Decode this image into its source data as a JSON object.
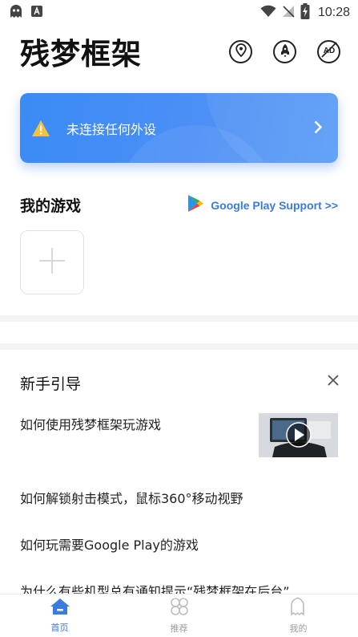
{
  "status_bar": {
    "time": "10:28"
  },
  "header": {
    "title": "残梦框架"
  },
  "device_card": {
    "text": "未连接任何外设"
  },
  "my_games": {
    "title": "我的游戏",
    "google_play_link": "Google Play Support >>"
  },
  "guide": {
    "title": "新手引导",
    "items": [
      "如何使用残梦框架玩游戏",
      "如何解锁射击模式，鼠标360°移动视野",
      "如何玩需要Google Play的游戏",
      "为什么有些机型总有通知提示“残梦框架在后台”"
    ]
  },
  "bottom_nav": {
    "tabs": [
      {
        "label": "首页",
        "active": true
      },
      {
        "label": "推荐",
        "active": false
      },
      {
        "label": "我的",
        "active": false
      }
    ]
  },
  "colors": {
    "accent": "#3a7be0",
    "card": "#4a8df6",
    "warning": "#f5c23d"
  }
}
